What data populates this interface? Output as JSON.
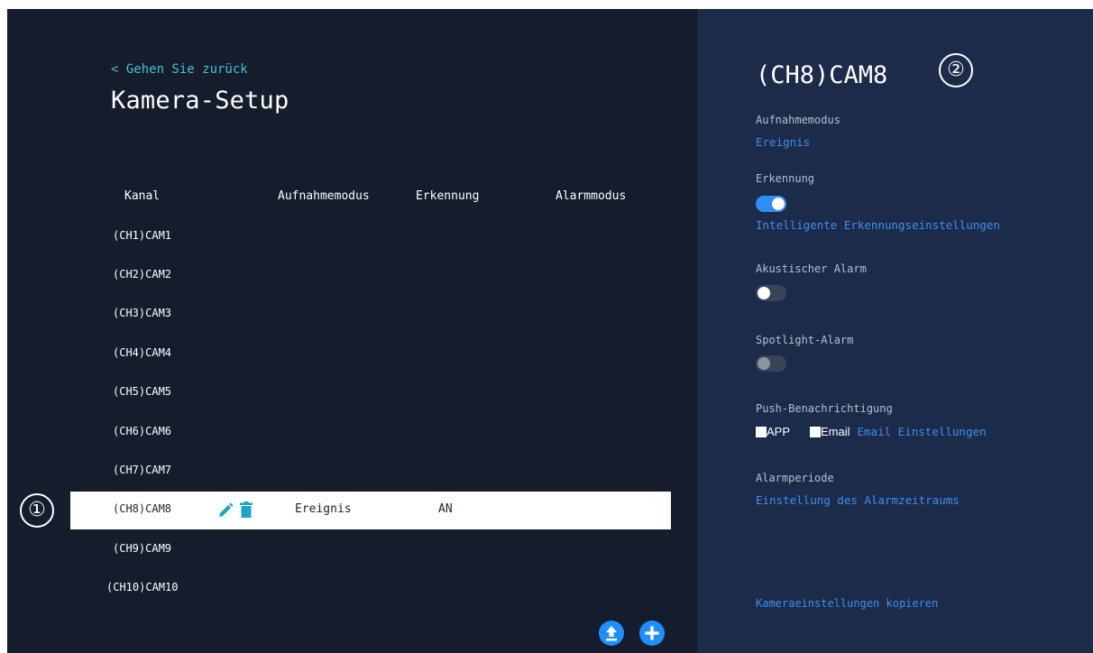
{
  "left_panel": {
    "back_link": "< Gehen Sie zurück",
    "title": "Kamera-Setup",
    "columns": {
      "channel": "Kanal",
      "record_mode": "Aufnahmemodus",
      "detection": "Erkennung",
      "alarm_mode": "Alarmmodus"
    },
    "rows": [
      {
        "name": "(CH1)CAM1",
        "record_mode": "",
        "detection": ""
      },
      {
        "name": "(CH2)CAM2",
        "record_mode": "",
        "detection": ""
      },
      {
        "name": "(CH3)CAM3",
        "record_mode": "",
        "detection": ""
      },
      {
        "name": "(CH4)CAM4",
        "record_mode": "",
        "detection": ""
      },
      {
        "name": "(CH5)CAM5",
        "record_mode": "",
        "detection": ""
      },
      {
        "name": "(CH6)CAM6",
        "record_mode": "",
        "detection": ""
      },
      {
        "name": "(CH7)CAM7",
        "record_mode": "",
        "detection": ""
      },
      {
        "name": "(CH8)CAM8",
        "record_mode": "Ereignis",
        "detection": "AN",
        "selected": true
      },
      {
        "name": "(CH9)CAM9",
        "record_mode": "",
        "detection": ""
      },
      {
        "name": "(CH10)CAM10",
        "record_mode": "",
        "detection": ""
      }
    ],
    "callout_1": "①",
    "upload_icon": "upload-icon",
    "add_icon": "plus-icon"
  },
  "right_panel": {
    "camera_title": "(CH8)CAM8",
    "callout_2": "②",
    "record_mode_label": "Aufnahmemodus",
    "record_mode_value": "Ereignis",
    "detection_label": "Erkennung",
    "detection_enabled": true,
    "smart_detection_link": "Intelligente Erkennungseinstellungen",
    "acoustic_alarm_label": "Akustischer Alarm",
    "acoustic_alarm_enabled": false,
    "spotlight_alarm_label": "Spotlight-Alarm",
    "spotlight_alarm_enabled": false,
    "push_label": "Push-Benachrichtigung",
    "push_app_label": "APP",
    "push_email_label": "Email",
    "email_settings_link": "Email Einstellungen",
    "alarm_period_label": "Alarmperiode",
    "alarm_period_link": "Einstellung des Alarmzeitraums",
    "copy_settings_link": "Kameraeinstellungen kopieren"
  },
  "colors": {
    "left_bg": "#151c2c",
    "right_bg": "#1c2b4a",
    "accent_link": "#3d8ff0",
    "back_link": "#3fc3d6",
    "selected_row": "#ffffff",
    "icon_teal": "#1aa3c8"
  }
}
